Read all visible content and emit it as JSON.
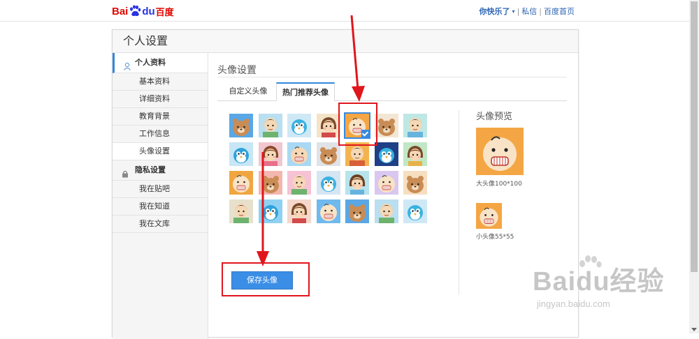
{
  "header": {
    "logo_bai": "Bai",
    "logo_du": "du",
    "logo_cn": "百度",
    "username": "你快乐了",
    "links": [
      "私信",
      "百度首页"
    ]
  },
  "panel": {
    "title": "个人设置"
  },
  "sidebar": {
    "groups": [
      {
        "label": "个人资料",
        "icon": "user-icon",
        "items": [
          "基本资料",
          "详细资料",
          "教育背景",
          "工作信息",
          "头像设置"
        ]
      },
      {
        "label": "隐私设置",
        "icon": "lock-icon",
        "items": [
          "我在贴吧",
          "我在知道",
          "我在文库"
        ]
      }
    ]
  },
  "content": {
    "section_title": "头像设置",
    "tabs": [
      "自定义头像",
      "热门推荐头像"
    ],
    "active_tab": 1,
    "avatar_count": 28,
    "selected_avatar": 4,
    "preview": {
      "title": "头像预览",
      "big_caption": "大头像100*100",
      "small_caption": "小头像55*55"
    },
    "save_button": "保存头像"
  },
  "watermark": {
    "main": "Baidu经验",
    "sub": "jingyan.baidu.com"
  },
  "colors": {
    "accent": "#3388dd",
    "button": "#3a8ee6",
    "annotation": "#e0161c",
    "logo_red": "#e10601",
    "logo_blue": "#2932e1"
  }
}
